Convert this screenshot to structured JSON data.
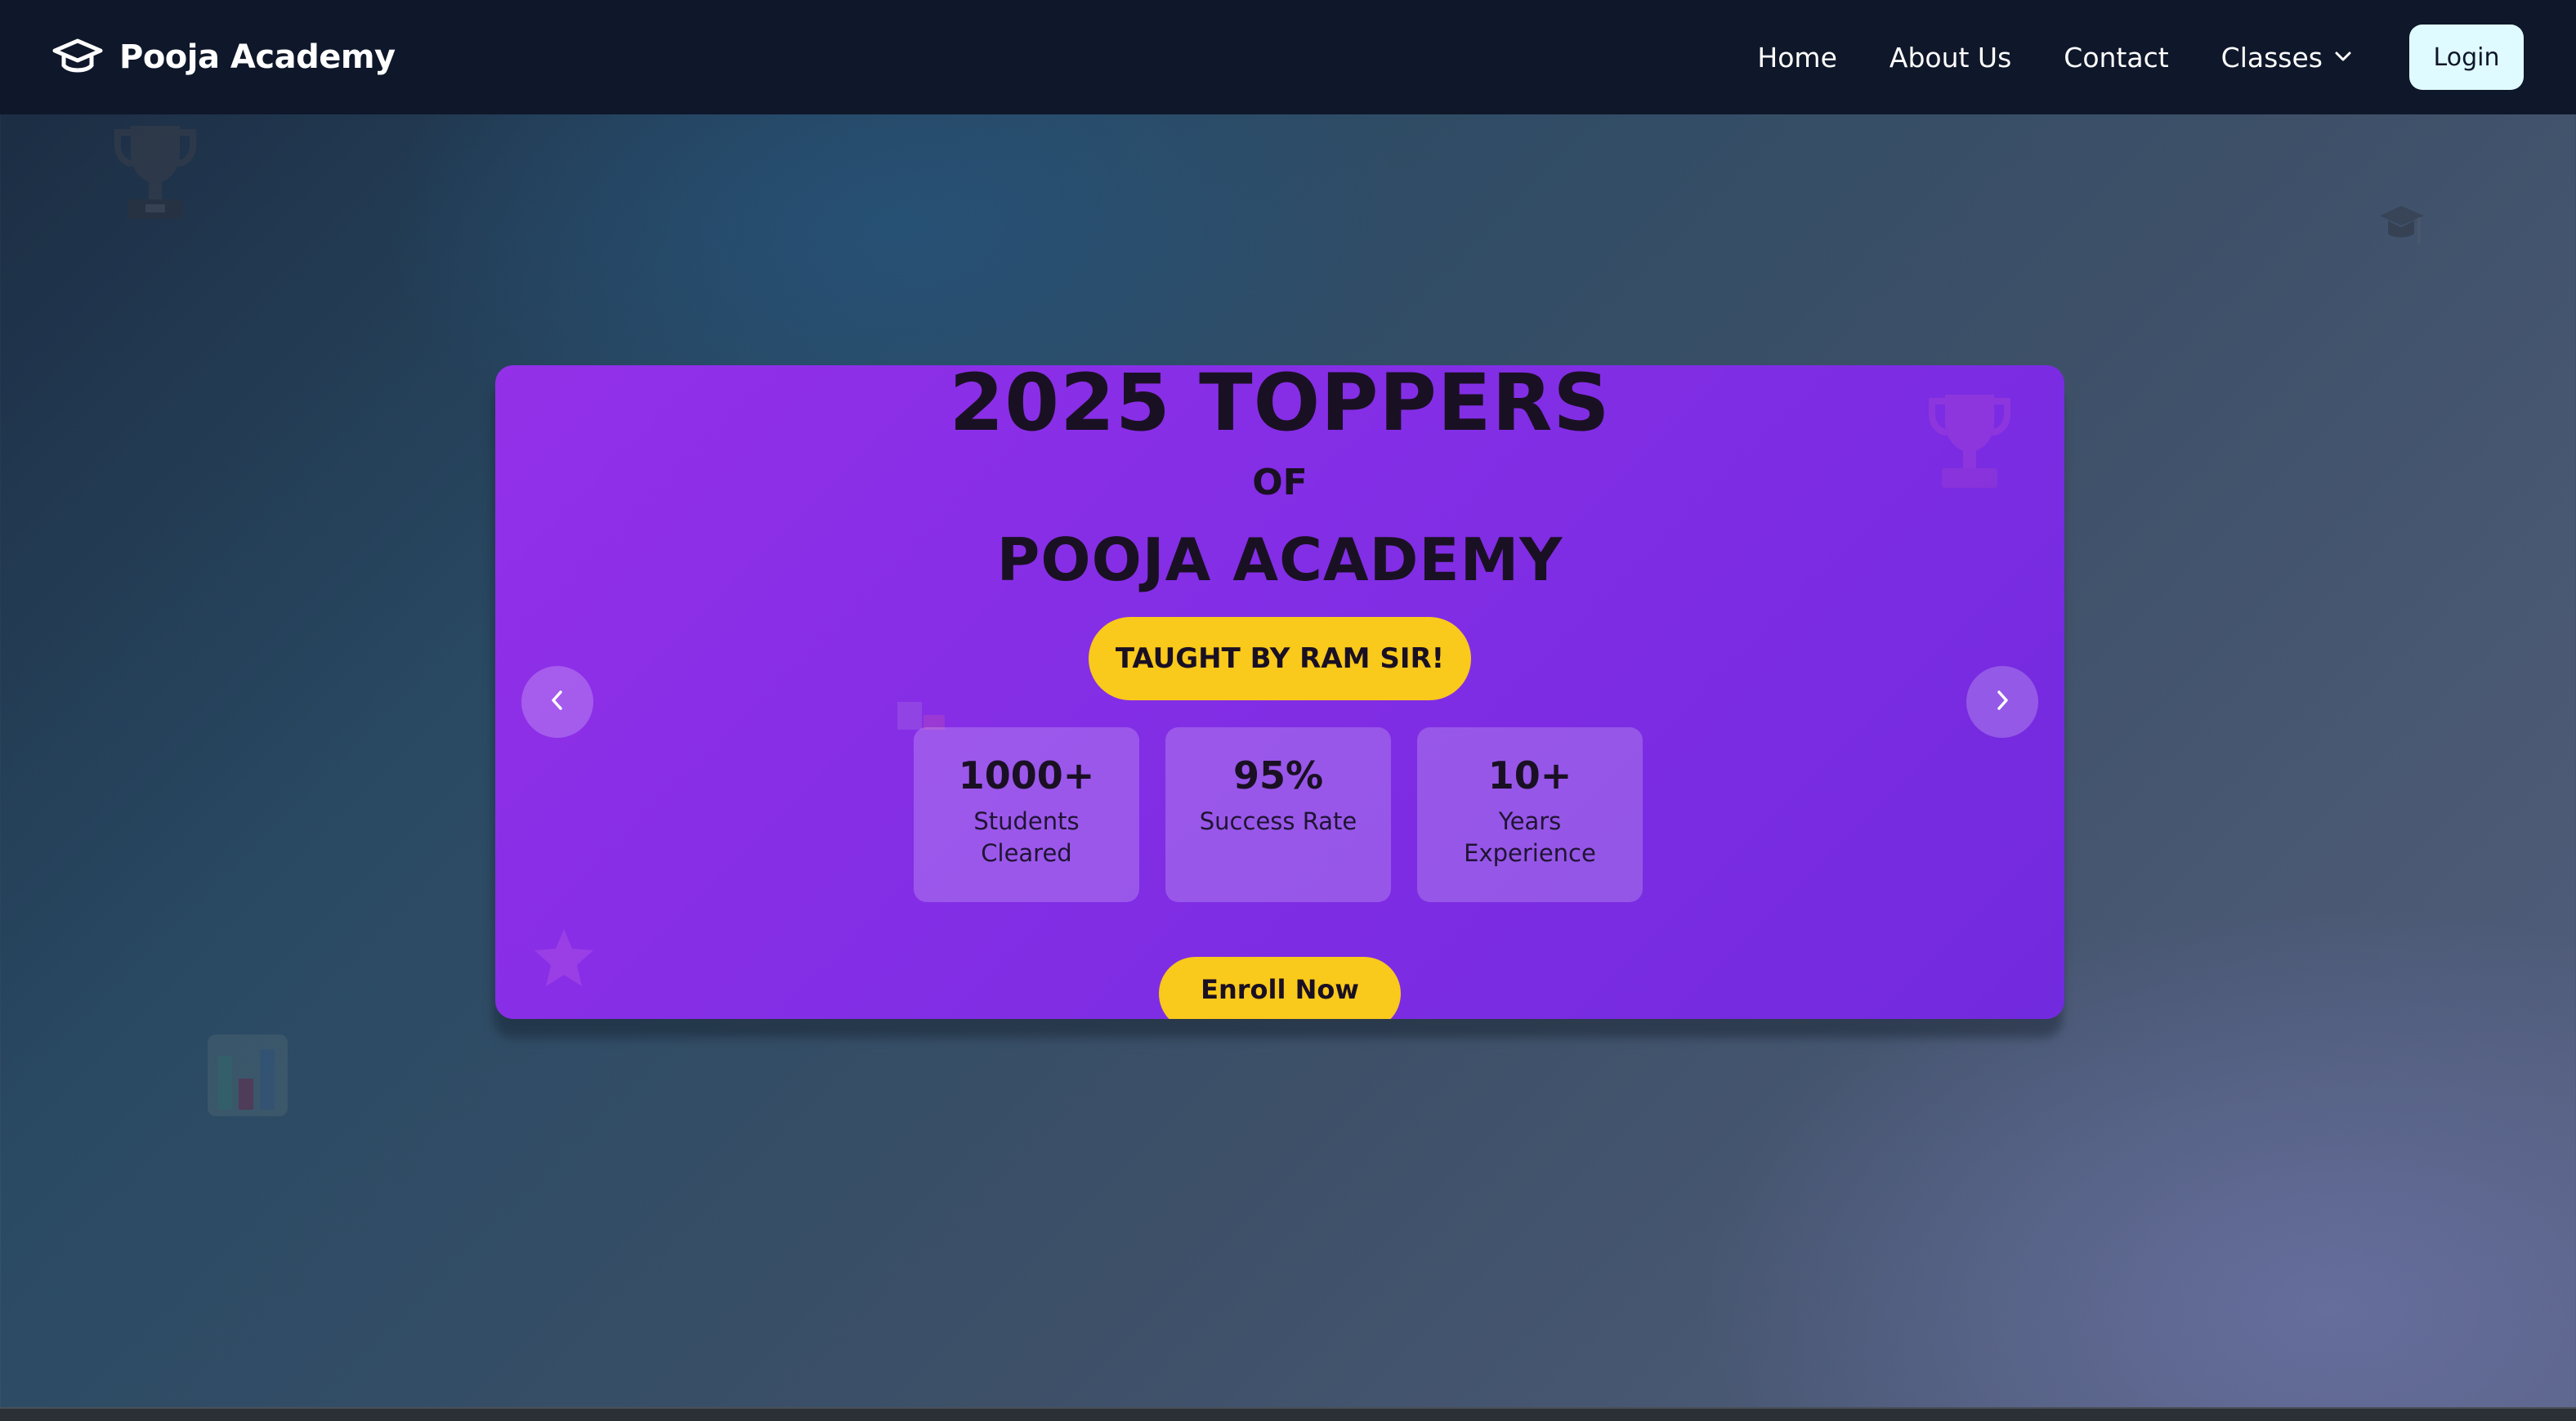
{
  "brand": {
    "name": "Pooja Academy",
    "icon": "graduation-cap-icon"
  },
  "nav": {
    "home": "Home",
    "about": "About Us",
    "contact": "Contact",
    "classes": "Classes",
    "login": "Login"
  },
  "hero": {
    "title": "2025 TOPPERS",
    "of": "OF",
    "academy": "POOJA ACADEMY",
    "tagline": "TAUGHT BY RAM SIR!",
    "stats": [
      {
        "value": "1000+",
        "label": "Students Cleared"
      },
      {
        "value": "95%",
        "label": "Success Rate"
      },
      {
        "value": "10+",
        "label": "Years Experience"
      }
    ],
    "cta": "Enroll Now"
  },
  "colors": {
    "navbar": "#0f172a",
    "card": "#842ee6",
    "accent_yellow": "#f9c91b",
    "login_bg": "#e0fbff"
  }
}
